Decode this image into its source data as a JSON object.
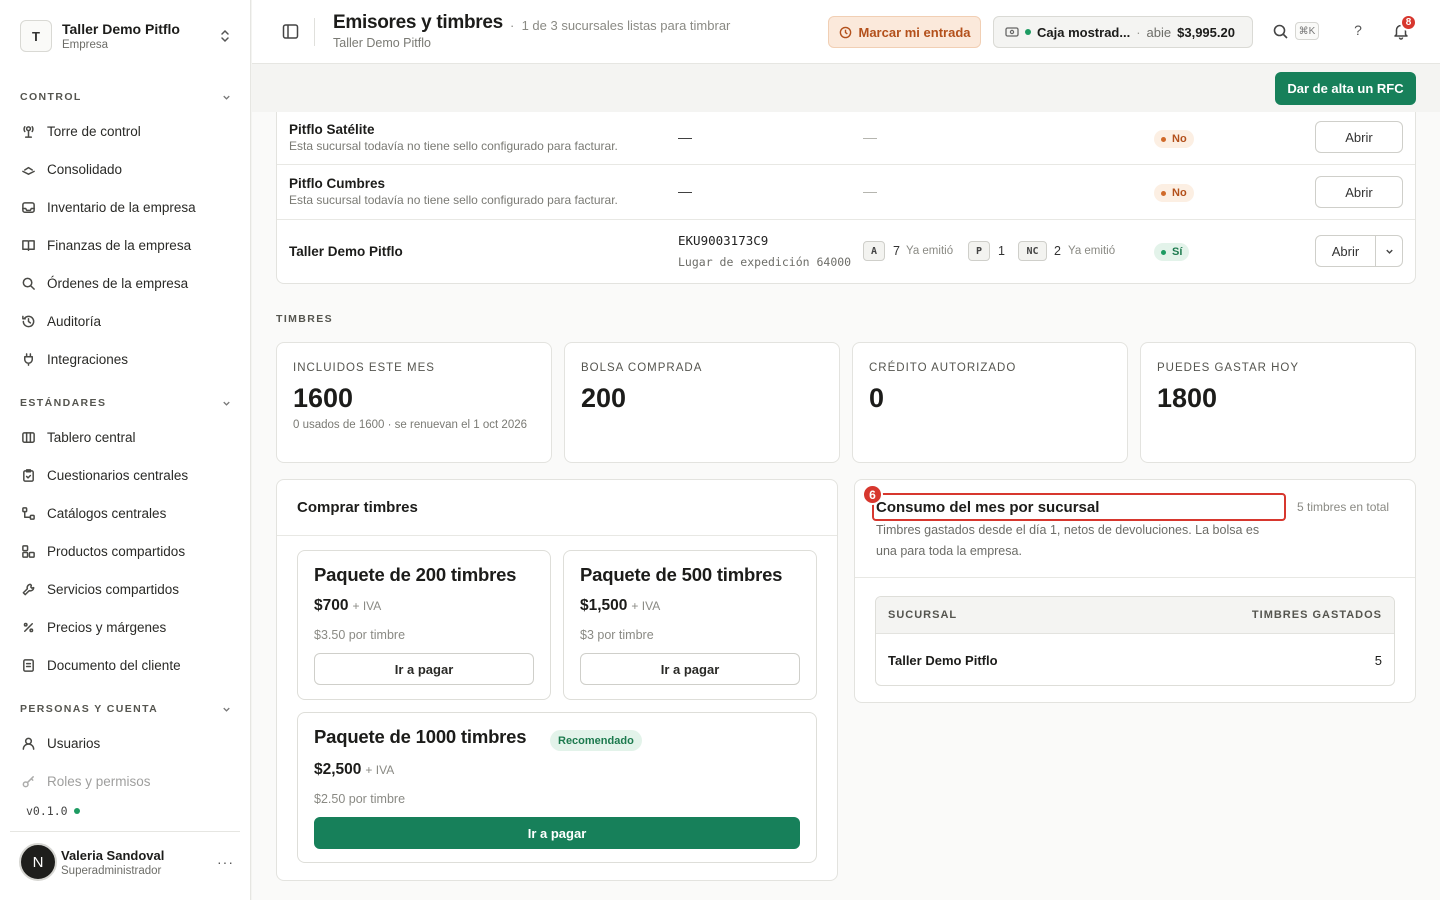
{
  "org": {
    "initial": "T",
    "name": "Taller Demo Pitflo",
    "type": "Empresa"
  },
  "sidebar": {
    "sections": [
      {
        "label": "CONTROL"
      },
      {
        "label": "ESTÁNDARES"
      },
      {
        "label": "PERSONAS Y CUENTA"
      }
    ],
    "control": [
      {
        "label": "Torre de control",
        "icon": "tower-icon"
      },
      {
        "label": "Consolidado",
        "icon": "layers-icon"
      },
      {
        "label": "Inventario de la empresa",
        "icon": "inbox-icon"
      },
      {
        "label": "Finanzas de la empresa",
        "icon": "book-icon"
      },
      {
        "label": "Órdenes de la empresa",
        "icon": "search-icon"
      },
      {
        "label": "Auditoría",
        "icon": "history-icon"
      },
      {
        "label": "Integraciones",
        "icon": "plug-icon"
      }
    ],
    "estandares": [
      {
        "label": "Tablero central",
        "icon": "columns-icon"
      },
      {
        "label": "Cuestionarios centrales",
        "icon": "clipboard-icon"
      },
      {
        "label": "Catálogos centrales",
        "icon": "tree-icon"
      },
      {
        "label": "Productos compartidos",
        "icon": "boxes-icon"
      },
      {
        "label": "Servicios compartidos",
        "icon": "wrench-icon"
      },
      {
        "label": "Precios y márgenes",
        "icon": "percent-icon"
      },
      {
        "label": "Documento del cliente",
        "icon": "document-icon"
      }
    ],
    "personas": [
      {
        "label": "Usuarios",
        "icon": "user-icon"
      },
      {
        "label": "Roles y permisos",
        "icon": "key-icon"
      }
    ],
    "version": "v0.1.0"
  },
  "user": {
    "initial": "N",
    "name": "Valeria Sandoval",
    "role": "Superadministrador",
    "more": "···"
  },
  "topbar": {
    "title": "Emisores y timbres",
    "subtitle": "1 de 3 sucursales listas para timbrar",
    "crumb": "Taller Demo Pitflo",
    "checkin_label": "Marcar mi entrada",
    "cash_name": "Caja mostrad...",
    "cash_sep": "·",
    "cash_state": "abie",
    "cash_amount": "$3,995.20",
    "shortcut": "⌘K",
    "help": "?",
    "notifications": "8"
  },
  "rfc_button": "Dar de alta un RFC",
  "branches": [
    {
      "name": "Pitflo Satélite",
      "note": "Esta sucursal todavía no tiene sello configurado para facturar.",
      "rfc": "—",
      "folios": "—",
      "status": "No",
      "action": "Abrir"
    },
    {
      "name": "Pitflo Cumbres",
      "note": "Esta sucursal todavía no tiene sello configurado para facturar.",
      "rfc": "—",
      "folios": "—",
      "status": "No",
      "action": "Abrir"
    },
    {
      "name": "Taller Demo Pitflo",
      "rfc": "EKU9003173C9",
      "place": "Lugar de expedición 64000",
      "folios": [
        {
          "tag": "A",
          "count": "7",
          "note": "Ya emitió"
        },
        {
          "tag": "P",
          "count": "1"
        },
        {
          "tag": "NC",
          "count": "2",
          "note": "Ya emitió"
        }
      ],
      "status": "Sí",
      "action": "Abrir"
    }
  ],
  "timbres": {
    "label": "TIMBRES",
    "stats": [
      {
        "label": "INCLUIDOS ESTE MES",
        "value": "1600",
        "note": "0 usados de 1600 · se renuevan el 1 oct 2026"
      },
      {
        "label": "BOLSA COMPRADA",
        "value": "200"
      },
      {
        "label": "CRÉDITO AUTORIZADO",
        "value": "0"
      },
      {
        "label": "PUEDES GASTAR HOY",
        "value": "1800"
      }
    ]
  },
  "buy": {
    "title": "Comprar timbres",
    "packages": [
      {
        "title": "Paquete de 200 timbres",
        "price": "$700",
        "iva": "+ IVA",
        "unit": "$3.50 por timbre",
        "cta": "Ir a pagar"
      },
      {
        "title": "Paquete de 500 timbres",
        "price": "$1,500",
        "iva": "+ IVA",
        "unit": "$3 por timbre",
        "cta": "Ir a pagar"
      },
      {
        "title": "Paquete de 1000 timbres",
        "badge": "Recomendado",
        "price": "$2,500",
        "iva": "+ IVA",
        "unit": "$2.50 por timbre",
        "cta": "Ir a pagar"
      }
    ]
  },
  "consumo": {
    "marker": "6",
    "title": "Consumo del mes por sucursal",
    "total": "5 timbres en total",
    "description": "Timbres gastados desde el día 1, netos de devoluciones. La bolsa es una para toda la empresa.",
    "columns": [
      "SUCURSAL",
      "TIMBRES GASTADOS"
    ],
    "rows": [
      {
        "branch": "Taller Demo Pitflo",
        "spent": "5"
      }
    ]
  },
  "colors": {
    "primary": "#17805a",
    "warning": "#b3501b",
    "danger": "#d7372e",
    "success": "#1d9b62"
  }
}
